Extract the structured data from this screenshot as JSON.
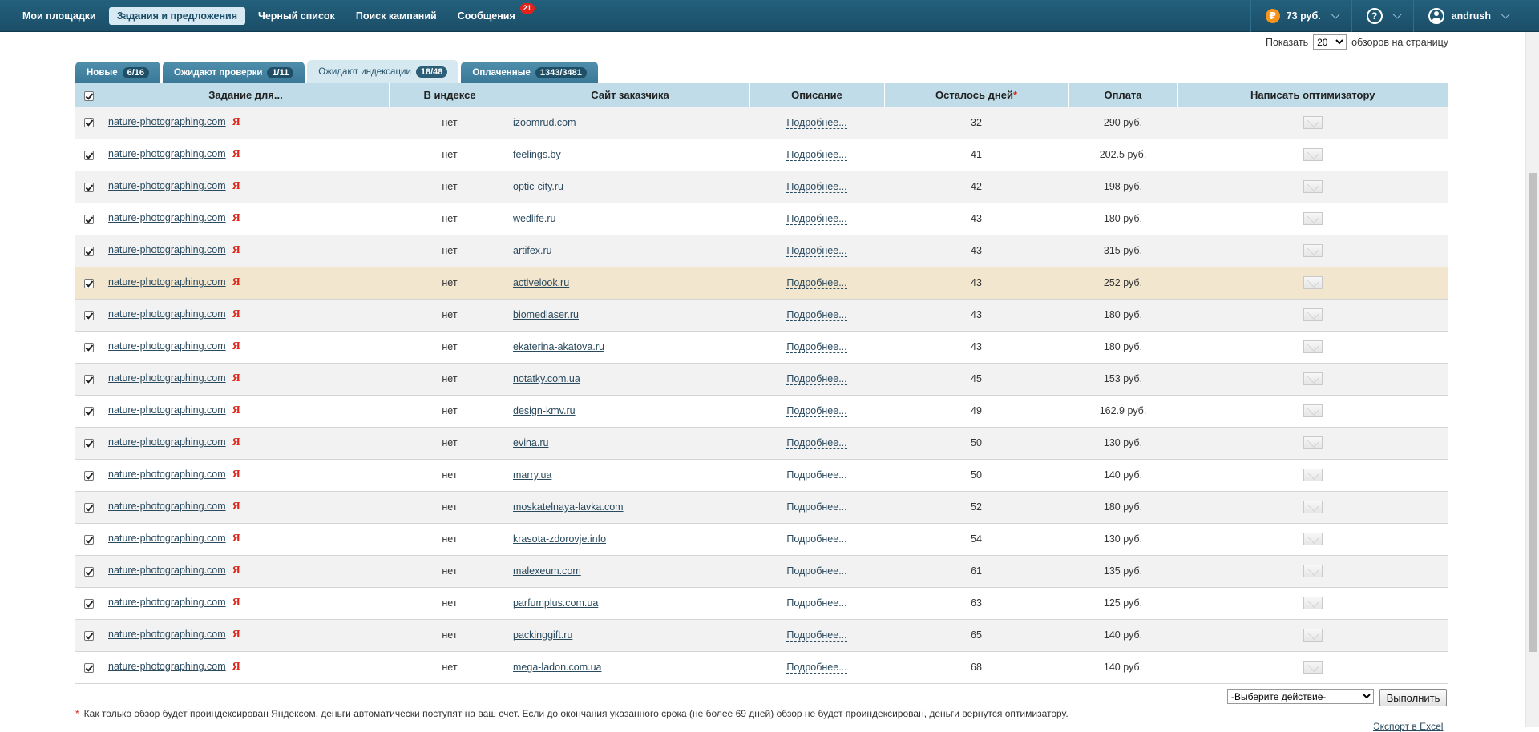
{
  "nav": {
    "items": [
      {
        "label": "Мои площадки",
        "active": false
      },
      {
        "label": "Задания и предложения",
        "active": true
      },
      {
        "label": "Черный список",
        "active": false
      },
      {
        "label": "Поиск кампаний",
        "active": false
      },
      {
        "label": "Сообщения",
        "active": false,
        "badge": "21"
      }
    ],
    "balance": "73 руб.",
    "ruble_icon_glyph": "₽",
    "help_glyph": "?",
    "username": "andrush"
  },
  "perpage": {
    "label_before": "Показать",
    "selected": "20",
    "label_after": "обзоров на страницу"
  },
  "tabs": [
    {
      "label": "Новые",
      "count": "6/16",
      "active": false
    },
    {
      "label": "Ожидают проверки",
      "count": "1/11",
      "active": false
    },
    {
      "label": "Ожидают индексации",
      "count": "18/48",
      "active": true
    },
    {
      "label": "Оплаченные",
      "count": "1343/3481",
      "active": false
    }
  ],
  "table": {
    "headers": {
      "task": "Задание для...",
      "index": "В индексе",
      "site": "Сайт заказчика",
      "desc": "Описание",
      "days": "Осталось дней",
      "days_mark": "*",
      "pay": "Оплата",
      "write": "Написать оптимизатору"
    },
    "highlight_row": 5,
    "rows": [
      {
        "task": "nature-photographing.com",
        "ya": "Я",
        "index": "нет",
        "site": "izoomrud.com",
        "desc": "Подробнее...",
        "days": "32",
        "pay": "290 руб."
      },
      {
        "task": "nature-photographing.com",
        "ya": "Я",
        "index": "нет",
        "site": "feelings.by",
        "desc": "Подробнее...",
        "days": "41",
        "pay": "202.5 руб."
      },
      {
        "task": "nature-photographing.com",
        "ya": "Я",
        "index": "нет",
        "site": "optic-city.ru",
        "desc": "Подробнее...",
        "days": "42",
        "pay": "198 руб."
      },
      {
        "task": "nature-photographing.com",
        "ya": "Я",
        "index": "нет",
        "site": "wedlife.ru",
        "desc": "Подробнее...",
        "days": "43",
        "pay": "180 руб."
      },
      {
        "task": "nature-photographing.com",
        "ya": "Я",
        "index": "нет",
        "site": "artifex.ru",
        "desc": "Подробнее...",
        "days": "43",
        "pay": "315 руб."
      },
      {
        "task": "nature-photographing.com",
        "ya": "Я",
        "index": "нет",
        "site": "activelook.ru",
        "desc": "Подробнее...",
        "days": "43",
        "pay": "252 руб."
      },
      {
        "task": "nature-photographing.com",
        "ya": "Я",
        "index": "нет",
        "site": "biomedlaser.ru",
        "desc": "Подробнее...",
        "days": "43",
        "pay": "180 руб."
      },
      {
        "task": "nature-photographing.com",
        "ya": "Я",
        "index": "нет",
        "site": "ekaterina-akatova.ru",
        "desc": "Подробнее...",
        "days": "43",
        "pay": "180 руб."
      },
      {
        "task": "nature-photographing.com",
        "ya": "Я",
        "index": "нет",
        "site": "notatky.com.ua",
        "desc": "Подробнее...",
        "days": "45",
        "pay": "153 руб."
      },
      {
        "task": "nature-photographing.com",
        "ya": "Я",
        "index": "нет",
        "site": "design-kmv.ru",
        "desc": "Подробнее...",
        "days": "49",
        "pay": "162.9 руб."
      },
      {
        "task": "nature-photographing.com",
        "ya": "Я",
        "index": "нет",
        "site": "evina.ru",
        "desc": "Подробнее...",
        "days": "50",
        "pay": "130 руб."
      },
      {
        "task": "nature-photographing.com",
        "ya": "Я",
        "index": "нет",
        "site": "marry.ua",
        "desc": "Подробнее...",
        "days": "50",
        "pay": "140 руб."
      },
      {
        "task": "nature-photographing.com",
        "ya": "Я",
        "index": "нет",
        "site": "moskatelnaya-lavka.com",
        "desc": "Подробнее...",
        "days": "52",
        "pay": "180 руб."
      },
      {
        "task": "nature-photographing.com",
        "ya": "Я",
        "index": "нет",
        "site": "krasota-zdorovje.info",
        "desc": "Подробнее...",
        "days": "54",
        "pay": "130 руб."
      },
      {
        "task": "nature-photographing.com",
        "ya": "Я",
        "index": "нет",
        "site": "malexeum.com",
        "desc": "Подробнее...",
        "days": "61",
        "pay": "135 руб."
      },
      {
        "task": "nature-photographing.com",
        "ya": "Я",
        "index": "нет",
        "site": "parfumplus.com.ua",
        "desc": "Подробнее...",
        "days": "63",
        "pay": "125 руб."
      },
      {
        "task": "nature-photographing.com",
        "ya": "Я",
        "index": "нет",
        "site": "packinggift.ru",
        "desc": "Подробнее...",
        "days": "65",
        "pay": "140 руб."
      },
      {
        "task": "nature-photographing.com",
        "ya": "Я",
        "index": "нет",
        "site": "mega-ladon.com.ua",
        "desc": "Подробнее...",
        "days": "68",
        "pay": "140 руб."
      }
    ]
  },
  "footer": {
    "action_select": "-Выберите действие-",
    "execute_button": "Выполнить",
    "note_star": "*",
    "note": "Как только обзор будет проиндексирован Яндексом, деньги автоматически поступят на ваш счет. Если до окончания указанного срока (не более 69 дней) обзор не будет проиндексирован, деньги вернутся оптимизатору.",
    "export": "Экспорт в Excel"
  },
  "colors": {
    "topbar": "#1b4e68",
    "header_row": "#bfdce8",
    "highlight_row": "#f2e6cf",
    "badge_red": "#e2231a",
    "ruble_orange": "#f7941d"
  }
}
